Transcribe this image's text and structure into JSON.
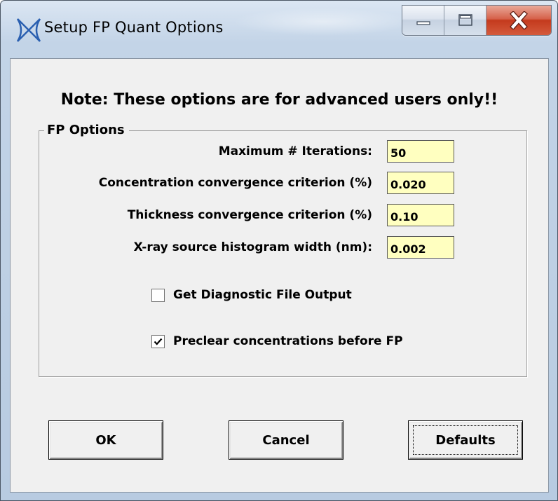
{
  "window": {
    "title": "Setup FP Quant Options",
    "icon": "xray-cross-icon",
    "controls": [
      "minimize-icon",
      "maximize-icon",
      "close-icon"
    ]
  },
  "note": "Note: These options are for advanced users only!!",
  "fp_options": {
    "group_label": "FP Options",
    "fields": [
      {
        "label": "Maximum # Iterations:",
        "value": "50"
      },
      {
        "label": "Concentration convergence criterion (%)",
        "value": "0.020"
      },
      {
        "label": "Thickness convergence criterion (%)",
        "value": "0.10"
      },
      {
        "label": "X-ray source histogram width (nm):",
        "value": "0.002"
      }
    ],
    "checkboxes": [
      {
        "label": "Get Diagnostic File Output",
        "checked": false
      },
      {
        "label": "Preclear concentrations before FP",
        "checked": true
      }
    ]
  },
  "buttons": {
    "ok": "OK",
    "cancel": "Cancel",
    "defaults": "Defaults"
  },
  "colors": {
    "input_background": "#ffffc0",
    "dialog_background": "#f0f0f0",
    "close_button": "#c43a1d"
  }
}
